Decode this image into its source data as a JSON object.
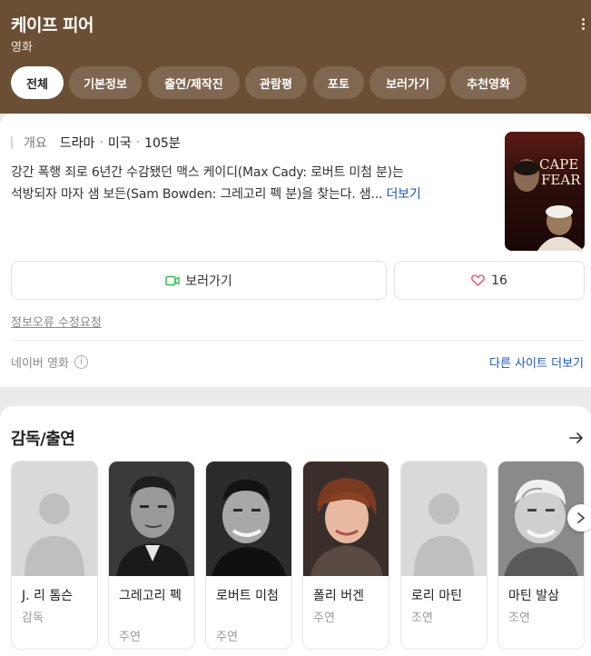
{
  "header": {
    "title": "케이프 피어",
    "subtitle": "영화",
    "tabs": [
      {
        "label": "전체",
        "active": true
      },
      {
        "label": "기본정보",
        "active": false
      },
      {
        "label": "출연/제작진",
        "active": false
      },
      {
        "label": "관람평",
        "active": false
      },
      {
        "label": "포토",
        "active": false
      },
      {
        "label": "보러가기",
        "active": false
      },
      {
        "label": "추천영화",
        "active": false
      }
    ]
  },
  "overview": {
    "label": "개요",
    "genre": "드라마",
    "country": "미국",
    "runtime": "105분",
    "synopsis_line1": "강간 폭행 죄로 6년간 수감됐던 맥스 케이디(Max Cady: 로버트 미첨 분)는",
    "synopsis_line2": "석방되자 마자 샘 보든(Sam Bowden: 그레고리 펙 분)을 찾는다. 샘...",
    "more_label": "더보기",
    "poster": {
      "title_line1": "CAPE",
      "title_line2": "FEAR"
    }
  },
  "actions": {
    "watch_label": "보러가기",
    "like_count": "16"
  },
  "report_label": "정보오류 수정요청",
  "source_label": "네이버 영화",
  "other_sites_label": "다른 사이트 더보기",
  "cast_section": {
    "title": "감독/출연",
    "people": [
      {
        "name": "J. 리 톰슨",
        "role": "감독",
        "photo": "placeholder"
      },
      {
        "name": "그레고리 펙",
        "role": "주연",
        "photo": "bw"
      },
      {
        "name": "로버트 미첨",
        "role": "주연",
        "photo": "bw"
      },
      {
        "name": "폴리 버겐",
        "role": "주연",
        "photo": "color"
      },
      {
        "name": "로리 마틴",
        "role": "조연",
        "photo": "placeholder"
      },
      {
        "name": "마틴 발삼",
        "role": "조연",
        "photo": "bw"
      }
    ]
  },
  "colors": {
    "header_bg": "#6b4f34",
    "link": "#1a56c8",
    "video_icon": "#2bbf4a",
    "heart_icon": "#e8505b"
  }
}
